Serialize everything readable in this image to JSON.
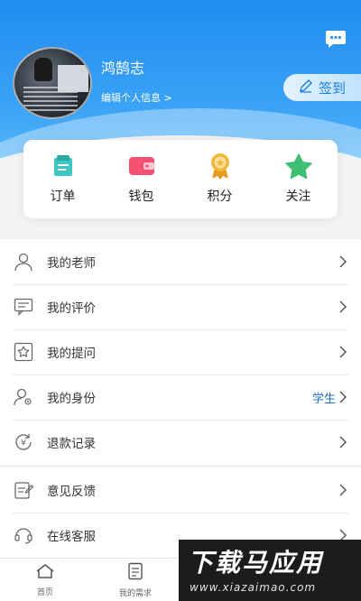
{
  "profile": {
    "name": "鸿鹄志",
    "edit_link": "编辑个人信息 >"
  },
  "signin": {
    "label": "签到"
  },
  "quick_actions": [
    {
      "label": "订单",
      "icon": "order-icon",
      "color": "#3ec6c0"
    },
    {
      "label": "钱包",
      "icon": "wallet-icon",
      "color": "#f2516f"
    },
    {
      "label": "积分",
      "icon": "points-medal-icon",
      "color": "#f3b63b"
    },
    {
      "label": "关注",
      "icon": "star-icon",
      "color": "#3fbf72"
    }
  ],
  "menu_primary": [
    {
      "label": "我的老师",
      "icon": "teacher-icon",
      "value": ""
    },
    {
      "label": "我的评价",
      "icon": "comment-icon",
      "value": ""
    },
    {
      "label": "我的提问",
      "icon": "question-icon",
      "value": ""
    },
    {
      "label": "我的身份",
      "icon": "identity-icon",
      "value": "学生"
    },
    {
      "label": "退款记录",
      "icon": "refund-icon",
      "value": ""
    }
  ],
  "menu_secondary": [
    {
      "label": "意见反馈",
      "icon": "feedback-icon",
      "value": ""
    },
    {
      "label": "在线客服",
      "icon": "customer-service-icon",
      "value": ""
    }
  ],
  "tabbar": [
    {
      "label": "首页",
      "icon": "home-icon"
    },
    {
      "label": "我的需求",
      "icon": "document-icon"
    }
  ],
  "watermark": {
    "title": "下载马应用",
    "url": "www.xiazaimao.com"
  },
  "colors": {
    "header": "#1f8cf0",
    "accent": "#1f6fc8"
  }
}
